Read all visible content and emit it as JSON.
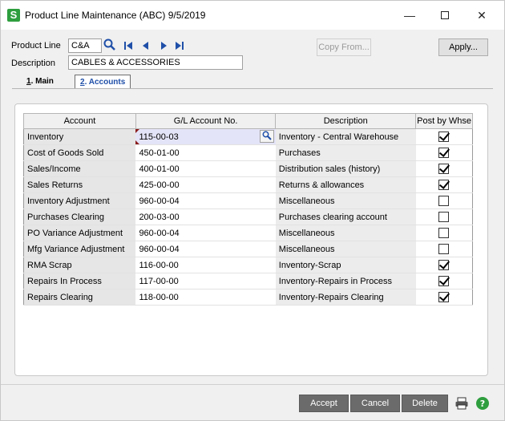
{
  "window": {
    "title": "Product Line Maintenance (ABC) 9/5/2019",
    "app_icon": "S",
    "minimize": "—",
    "close": "✕"
  },
  "header": {
    "product_line_label": "Product Line",
    "product_line_value": "C&A",
    "description_label": "Description",
    "description_value": "CABLES & ACCESSORIES",
    "copy_from_label": "Copy From...",
    "apply_label": "Apply..."
  },
  "tabs": [
    {
      "num": "1",
      "label": ". Main"
    },
    {
      "num": "2",
      "label": ". Accounts"
    }
  ],
  "grid": {
    "headers": [
      "Account",
      "G/L Account No.",
      "Description",
      "Post by Whse"
    ],
    "rows": [
      {
        "account": "Inventory",
        "gl": "115-00-03",
        "desc": "Inventory - Central Warehouse",
        "post": true
      },
      {
        "account": "Cost of Goods Sold",
        "gl": "450-01-00",
        "desc": "Purchases",
        "post": true
      },
      {
        "account": "Sales/Income",
        "gl": "400-01-00",
        "desc": "Distribution sales (history)",
        "post": true
      },
      {
        "account": "Sales Returns",
        "gl": "425-00-00",
        "desc": "Returns & allowances",
        "post": true
      },
      {
        "account": "Inventory Adjustment",
        "gl": "960-00-04",
        "desc": "Miscellaneous",
        "post": false
      },
      {
        "account": "Purchases Clearing",
        "gl": "200-03-00",
        "desc": "Purchases clearing account",
        "post": false
      },
      {
        "account": "PO Variance Adjustment",
        "gl": "960-00-04",
        "desc": "Miscellaneous",
        "post": false
      },
      {
        "account": "Mfg Variance Adjustment",
        "gl": "960-00-04",
        "desc": "Miscellaneous",
        "post": false
      },
      {
        "account": "RMA Scrap",
        "gl": "116-00-00",
        "desc": "Inventory-Scrap",
        "post": true
      },
      {
        "account": "Repairs In Process",
        "gl": "117-00-00",
        "desc": "Inventory-Repairs in Process",
        "post": true
      },
      {
        "account": "Repairs Clearing",
        "gl": "118-00-00",
        "desc": "Inventory-Repairs Clearing",
        "post": true
      }
    ]
  },
  "footer": {
    "accept_label": "Accept",
    "cancel_label": "Cancel",
    "delete_label": "Delete",
    "print_icon": "printer-icon",
    "help_icon": "help-icon"
  },
  "colors": {
    "accent": "#1f4fa8",
    "brand": "#2e9e3e",
    "button_dark": "#6b6b6b"
  }
}
